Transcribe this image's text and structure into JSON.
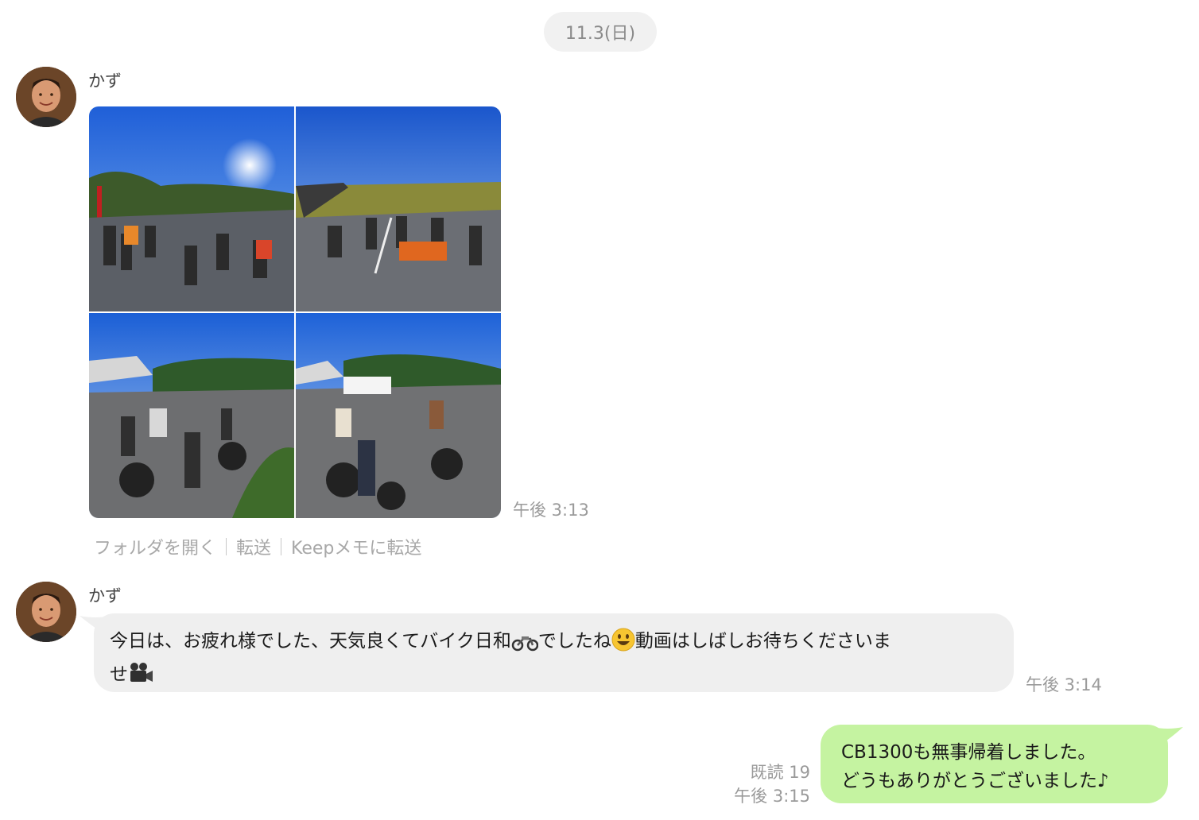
{
  "date_separator": "11.3(日)",
  "messages": [
    {
      "sender": "かず",
      "type": "photo_album",
      "time": "午後 3:13",
      "actions": [
        "フォルダを開く",
        "転送",
        "Keepメモに転送"
      ]
    },
    {
      "sender": "かず",
      "type": "text",
      "line1_a": "今日は、お疲れ様でした、天気良くてバイク日和",
      "line1_b": "でしたね",
      "line1_c": "動画はしばしお待ちくださいま",
      "line2": "せ",
      "time": "午後 3:14"
    },
    {
      "sender": "self",
      "type": "text",
      "line1": "CB1300も無事帰着しました。",
      "line2": "どうもありがとうございました♪",
      "read": "既読 19",
      "time": "午後 3:15"
    }
  ],
  "icons": {
    "avatar": "avatar-photo",
    "emoji1": "motorcycle-emoji",
    "emoji2": "smiley-emoji",
    "emoji3": "video-camera-emoji"
  },
  "colors": {
    "outgoing_bubble": "#c5f3a1",
    "incoming_bubble": "#efefef",
    "meta_text": "#9a9a9a"
  }
}
